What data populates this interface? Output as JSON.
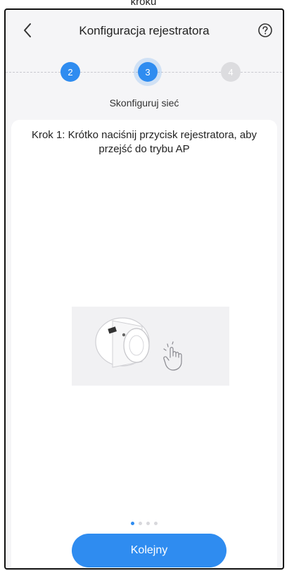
{
  "caption": "kroku",
  "header": {
    "title": "Konfiguracja rejestratora",
    "back_icon": "chevron-left-icon",
    "help_icon": "question-circle-icon"
  },
  "steps": [
    {
      "number": "2",
      "state": "done"
    },
    {
      "number": "3",
      "state": "active"
    },
    {
      "number": "4",
      "state": "todo"
    }
  ],
  "step_label": "Skonfiguruj sieć",
  "instruction": "Krok 1: Krótko naciśnij przycisk rejestratora, aby przejść do trybu AP",
  "illustration": "device-press-button-illustration",
  "pager": {
    "count": 4,
    "current": 1
  },
  "next_button": "Kolejny",
  "colors": {
    "accent": "#2f8cf0",
    "inactive": "#dcdcdf",
    "background": "#f5f5f7"
  }
}
